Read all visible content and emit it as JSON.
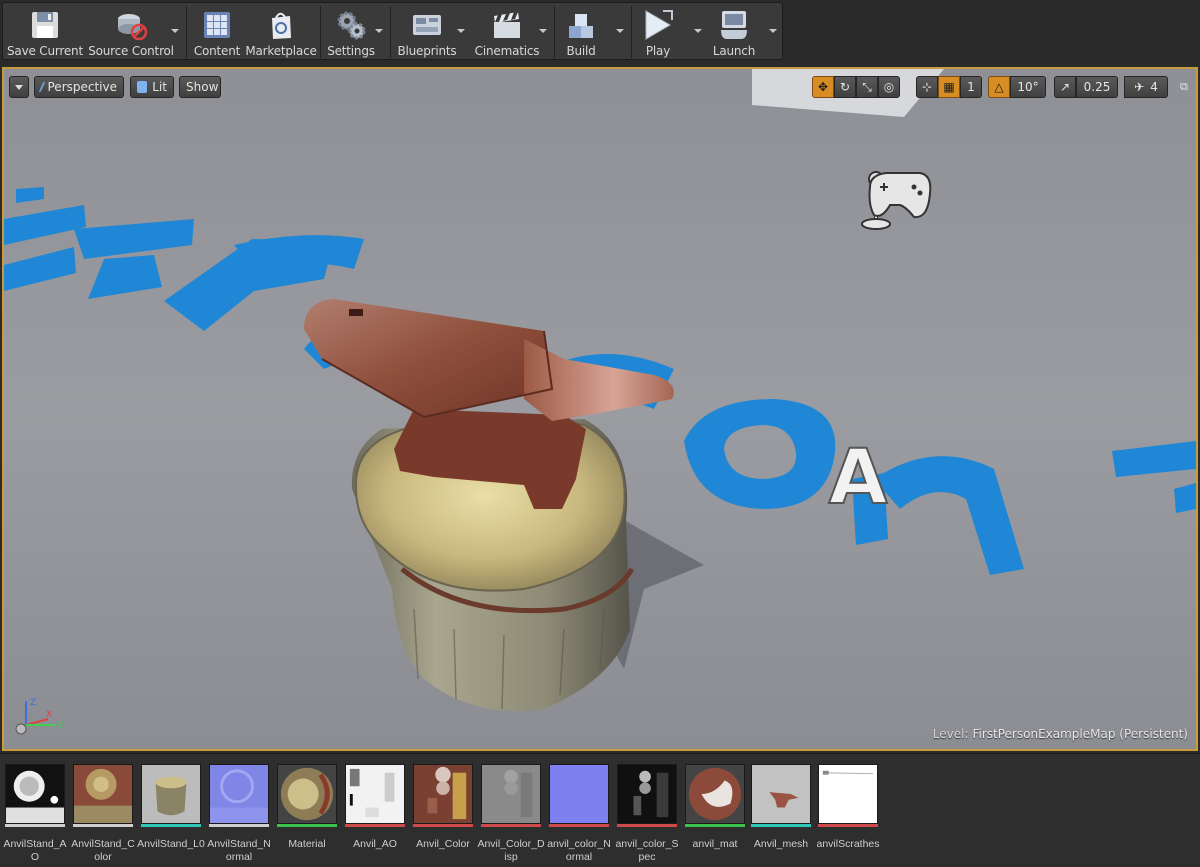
{
  "toolbar": {
    "buttons": [
      {
        "label": "Save Current",
        "icon": "floppy-disk-icon"
      },
      {
        "label": "Source Control",
        "icon": "source-control-icon"
      },
      {
        "label": "Content",
        "icon": "content-grid-icon"
      },
      {
        "label": "Marketplace",
        "icon": "marketplace-bag-icon"
      },
      {
        "label": "Settings",
        "icon": "gears-icon"
      },
      {
        "label": "Blueprints",
        "icon": "blueprints-icon"
      },
      {
        "label": "Cinematics",
        "icon": "clapperboard-icon"
      },
      {
        "label": "Build",
        "icon": "build-blocks-icon"
      },
      {
        "label": "Play",
        "icon": "play-icon"
      },
      {
        "label": "Launch",
        "icon": "launch-gamepad-icon"
      }
    ]
  },
  "viewport": {
    "perspective_label": "Perspective",
    "lit_label": "Lit",
    "show_label": "Show",
    "rotation_snap": "10°",
    "scale_snap": "0.25",
    "camera_speed": "4",
    "grid_snap": "1",
    "floor_text": "First Person",
    "billboard_letter": "A",
    "level_label": "Level:",
    "level_name": "FirstPersonExampleMap (Persistent)",
    "colors": {
      "accent_orange": "#d88c24",
      "viewport_border": "#c89b3c",
      "floor_text_blue": "#1e88d8"
    }
  },
  "assets": [
    {
      "name": "AnvilStand_AO",
      "bar": "#cfcfcf"
    },
    {
      "name": "AnvilStand_Color",
      "bar": "#cfcfcf"
    },
    {
      "name": "AnvilStand_L0",
      "bar": "#2fc6b8"
    },
    {
      "name": "AnvilStand_Normal",
      "bar": "#cfcfcf"
    },
    {
      "name": "Material",
      "bar": "#3cc24a"
    },
    {
      "name": "Anvil_AO",
      "bar": "#cf4b4b"
    },
    {
      "name": "Anvil_Color",
      "bar": "#cf4b4b"
    },
    {
      "name": "Anvil_Color_Disp",
      "bar": "#cf4b4b"
    },
    {
      "name": "anvil_color_Normal",
      "bar": "#cf4b4b"
    },
    {
      "name": "anvil_color_Spec",
      "bar": "#cf4b4b"
    },
    {
      "name": "anvil_mat",
      "bar": "#3cc24a"
    },
    {
      "name": "Anvil_mesh",
      "bar": "#2fc6b8"
    },
    {
      "name": "anvilScrathes",
      "bar": "#cf4b4b"
    }
  ]
}
